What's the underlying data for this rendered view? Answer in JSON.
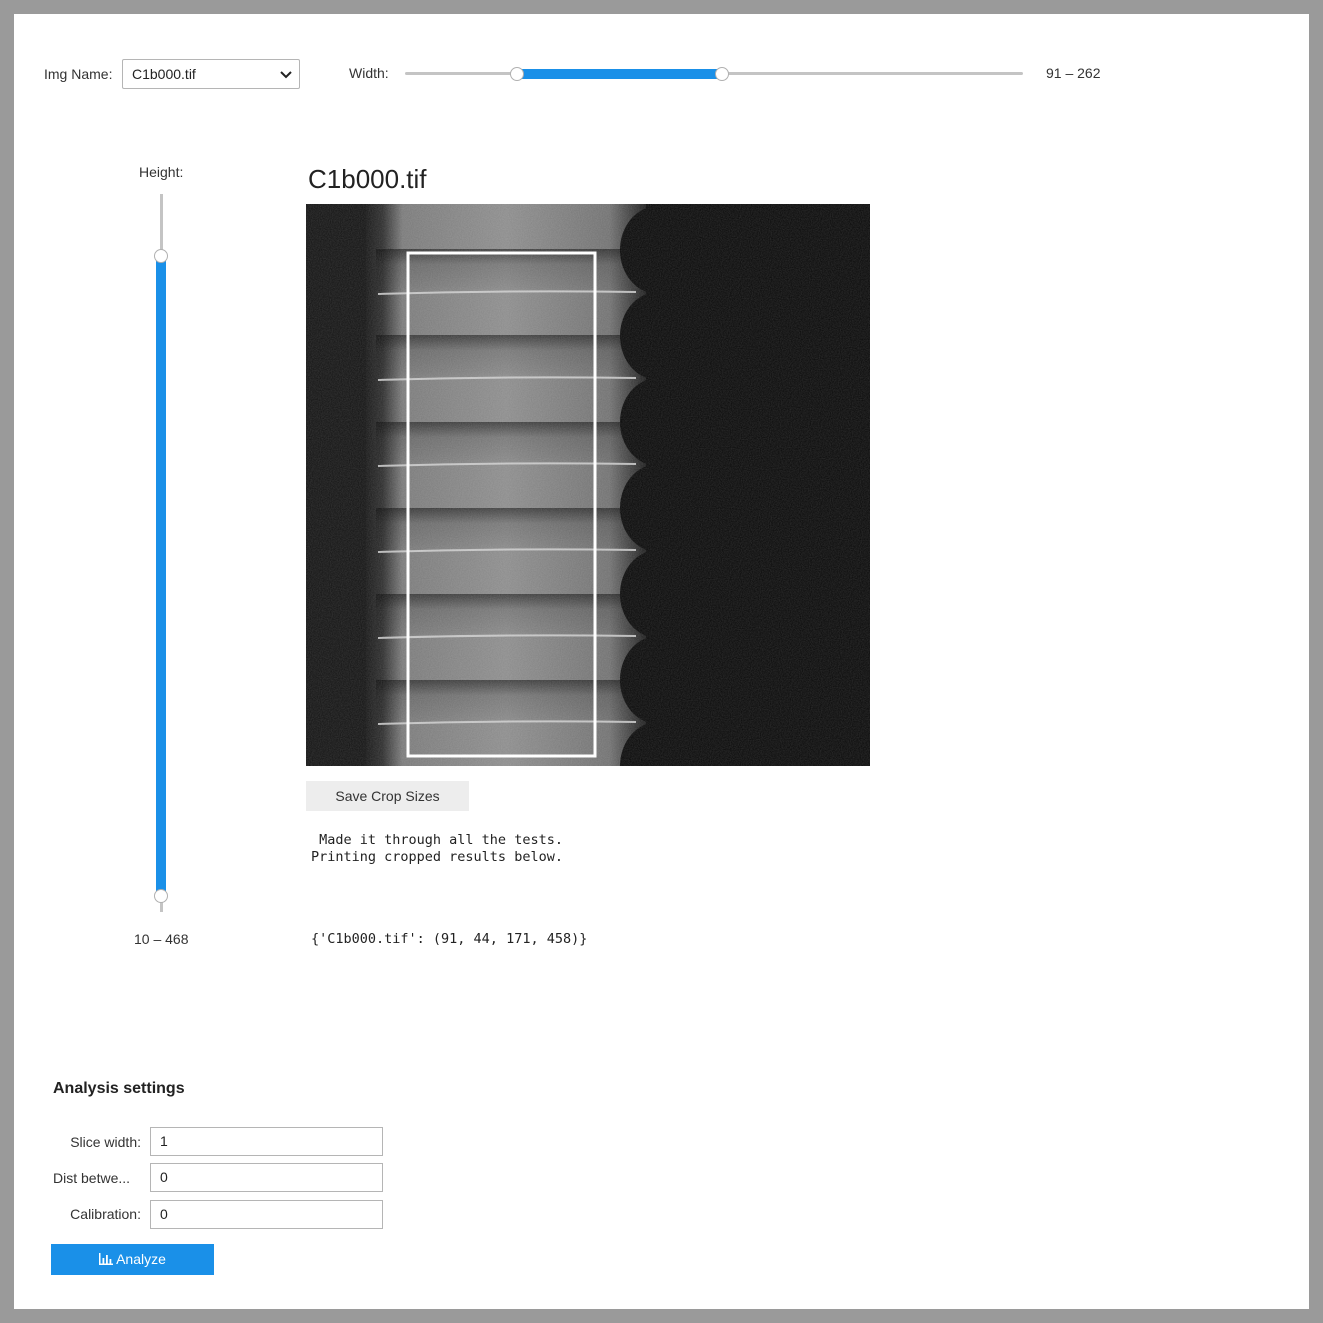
{
  "controls": {
    "img_name_label": "Img Name:",
    "img_name_value": "C1b000.tif",
    "width_label": "Width:",
    "width_range": "91 – 262",
    "width_low": 91,
    "width_high": 262,
    "height_label": "Height:",
    "height_range": "10 – 468",
    "height_low": 10,
    "height_high": 468
  },
  "viewer": {
    "title": "C1b000.tif",
    "save_button": "Save Crop Sizes",
    "output_message": " Made it through all the tests.\nPrinting cropped results below.",
    "output_result": "{'C1b000.tif': (91, 44, 171, 458)}"
  },
  "analysis": {
    "title": "Analysis settings",
    "fields": [
      {
        "label": "Slice width:",
        "value": "1"
      },
      {
        "label": "Dist betwe...",
        "value": "0"
      },
      {
        "label": "Calibration:",
        "value": "0"
      }
    ],
    "analyze_button": "Analyze",
    "analyze_icon": "bar-chart-icon"
  },
  "colors": {
    "accent": "#1a90e8",
    "frame": "#9a9a9a"
  }
}
